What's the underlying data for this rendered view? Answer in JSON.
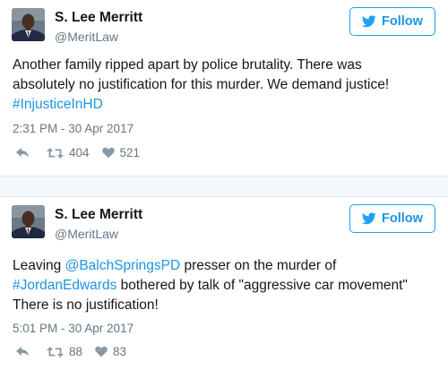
{
  "colors": {
    "link": "#1b95e0",
    "follow_border": "#1da1f2",
    "muted": "#657786",
    "text": "#14171a",
    "separator": "#f5f8fa"
  },
  "tweets": [
    {
      "author": {
        "name": "S. Lee Merritt",
        "handle": "@MeritLaw",
        "avatar_icon": "profile-photo"
      },
      "follow_label": "Follow",
      "follow_icon": "bird-icon",
      "text_lines": [
        [
          {
            "text": "Another family ripped apart by police brutality. There was",
            "link": false
          }
        ],
        [
          {
            "text": "absolutely no justification for this murder. We demand justice!",
            "link": false
          }
        ],
        [
          {
            "text": "#InjusticeInHD",
            "link": true
          }
        ]
      ],
      "timestamp": "2:31 PM - 30 Apr 2017",
      "retweets": "404",
      "likes": "521"
    },
    {
      "author": {
        "name": "S. Lee Merritt",
        "handle": "@MeritLaw",
        "avatar_icon": "profile-photo"
      },
      "follow_label": "Follow",
      "follow_icon": "bird-icon",
      "text_lines": [
        [
          {
            "text": "Leaving ",
            "link": false
          },
          {
            "text": "@BalchSpringsPD",
            "link": true
          },
          {
            "text": " presser on the murder of",
            "link": false
          }
        ],
        [
          {
            "text": "#JordanEdwards",
            "link": true
          },
          {
            "text": " bothered by talk of \"aggressive car movement\"",
            "link": false
          }
        ],
        [
          {
            "text": "There is no justification!",
            "link": false
          }
        ]
      ],
      "timestamp": "5:01 PM - 30 Apr 2017",
      "retweets": "88",
      "likes": "83"
    }
  ]
}
